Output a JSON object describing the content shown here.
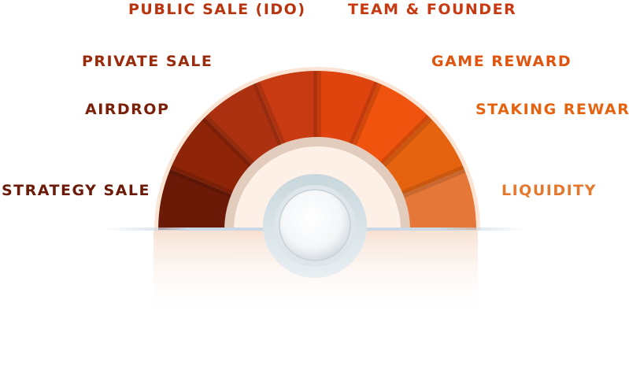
{
  "segments": [
    {
      "label": "STRATEGY SALE",
      "color": "#6b1a08"
    },
    {
      "label": "AIRDROP",
      "color": "#8e2408"
    },
    {
      "label": "PRIVATE SALE",
      "color": "#ab3110"
    },
    {
      "label": "PUBLIC SALE (IDO)",
      "color": "#c83a12"
    },
    {
      "label": "TEAM & FOUNDER",
      "color": "#df430e"
    },
    {
      "label": "GAME REWARD",
      "color": "#f0530d"
    },
    {
      "label": "STAKING REWARD",
      "color": "#e5630f"
    },
    {
      "label": "LIQUIDITY",
      "color": "#e57838"
    }
  ],
  "label_colors": {
    "STRATEGY SALE": "#6b1a08",
    "AIRDROP": "#7a1f08",
    "PRIVATE SALE": "#9a2a0c",
    "PUBLIC SALE (IDO)": "#b8340f",
    "TEAM & FOUNDER": "#c83a12",
    "GAME REWARD": "#e0540d",
    "STAKING REWARD": "#e5630f",
    "LIQUIDITY": "#e5782f"
  }
}
